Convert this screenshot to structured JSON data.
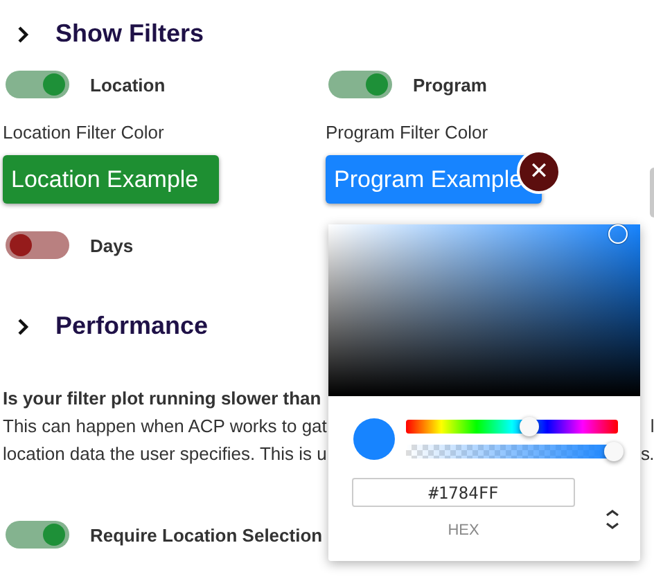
{
  "show_filters": {
    "title": "Show Filters"
  },
  "filters": [
    {
      "label": "Location",
      "on": true,
      "color_label": "Location Filter Color",
      "example": "Location Example",
      "color": "#1e8f32"
    },
    {
      "label": "Program",
      "on": true,
      "color_label": "Program Filter Color",
      "example": "Program Example",
      "color": "#1784ff"
    }
  ],
  "days": {
    "label": "Days",
    "on": false
  },
  "performance": {
    "title": "Performance",
    "question": "Is your filter plot running slower than",
    "lines": [
      {
        "left": "This can happen when ACP works to gat",
        "right": "l"
      },
      {
        "left": "location data the user specifies. This is u",
        "right": "s."
      }
    ]
  },
  "require_location": {
    "label": "Require Location Selection",
    "on": true
  },
  "color_picker": {
    "close": "✕",
    "hex": "#1784FF",
    "format": "HEX",
    "hue": {
      "level": 0.58
    },
    "alpha": {
      "level": 1
    }
  }
}
